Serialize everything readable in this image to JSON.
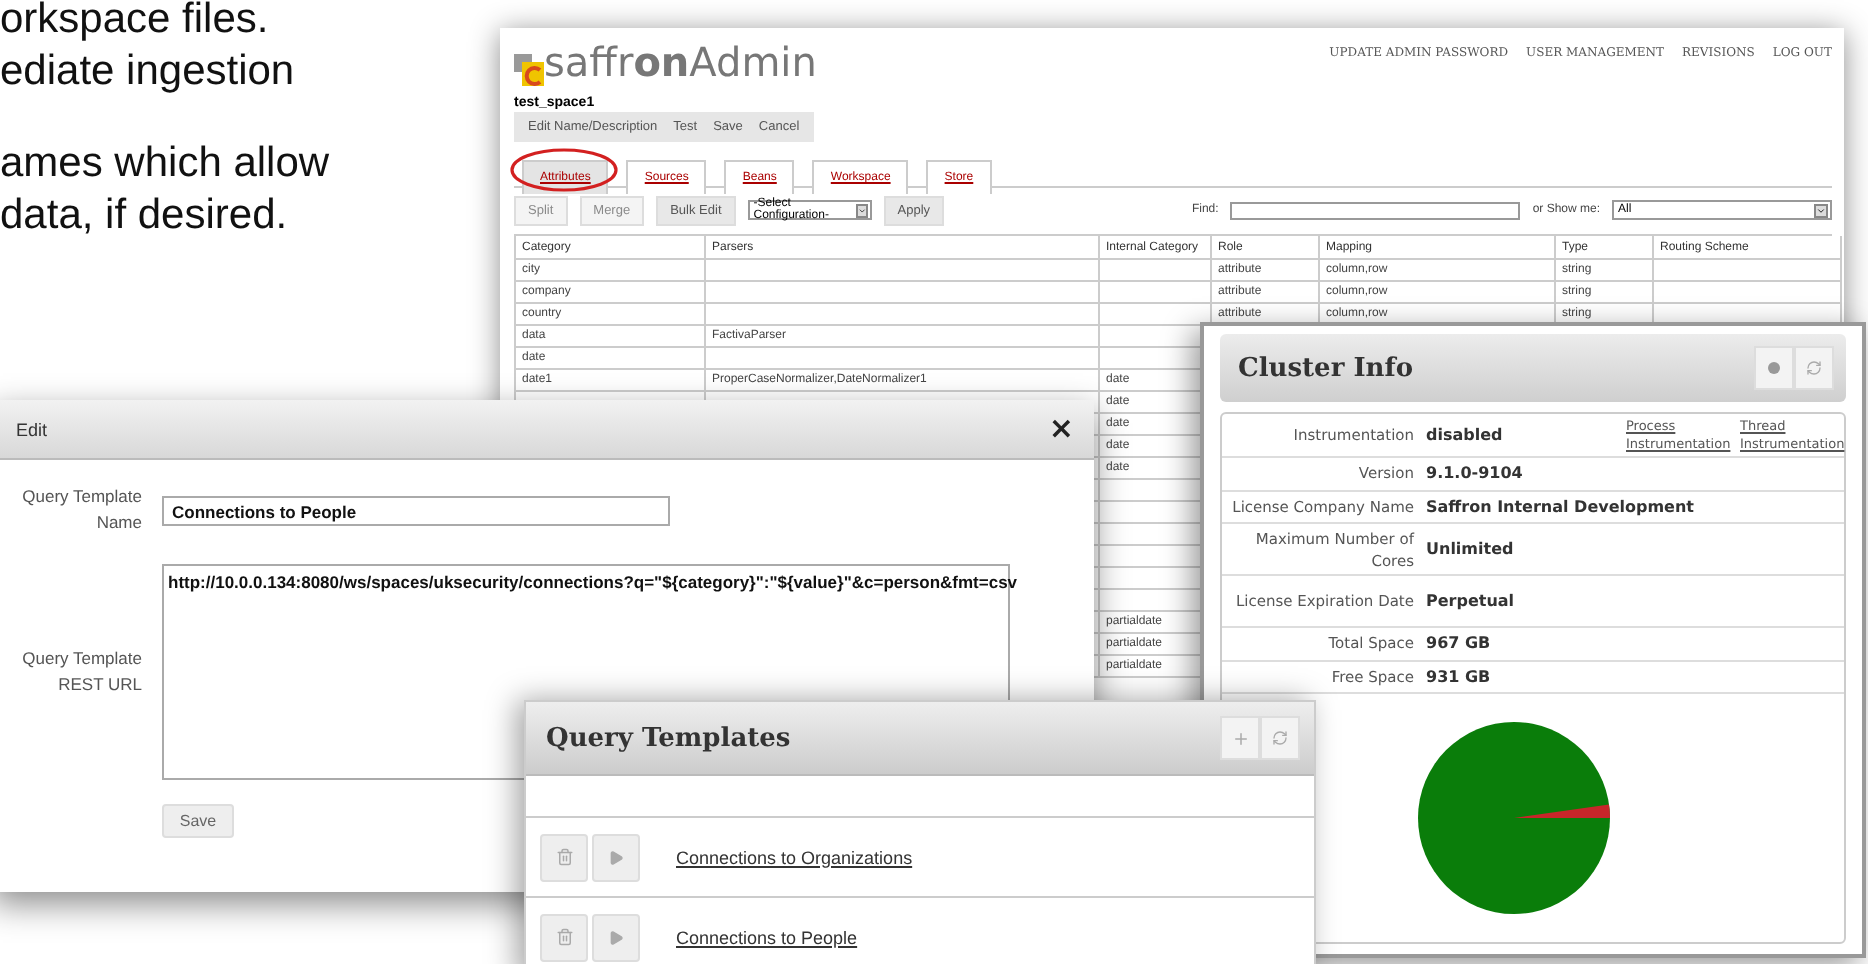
{
  "slide_text": {
    "paragraphs": [
      [
        "orkspace files.",
        "ediate ingestion"
      ],
      [
        "ames which allow",
        "data, if desired."
      ]
    ]
  },
  "admin": {
    "logo": "saffr**on**Admin",
    "nav": [
      "UPDATE ADMIN PASSWORD",
      "USER MANAGEMENT",
      "REVISIONS",
      "LOG OUT"
    ],
    "space_name": "test_space1",
    "actions": [
      "Edit Name/Description",
      "Test",
      "Save",
      "Cancel"
    ],
    "tabs": [
      {
        "label": "Attributes",
        "selected": true,
        "circled": true
      },
      {
        "label": "Sources",
        "selected": false,
        "circled": false
      },
      {
        "label": "Beans",
        "selected": false,
        "circled": false
      },
      {
        "label": "Workspace",
        "selected": false,
        "circled": false
      },
      {
        "label": "Store",
        "selected": false,
        "circled": false
      }
    ],
    "toolbar": {
      "buttons": [
        {
          "label": "Split",
          "disabled": true
        },
        {
          "label": "Merge",
          "disabled": true
        },
        {
          "label": "Bulk Edit",
          "disabled": false
        }
      ],
      "config_select": "-Select Configuration-",
      "apply": "Apply",
      "find_label": "Find:",
      "show_label": "or Show me:",
      "show_select": "All"
    },
    "table": {
      "columns": [
        "Category",
        "Parsers",
        "Internal Category",
        "Role",
        "Mapping",
        "Type",
        "Routing Scheme"
      ],
      "rows": [
        [
          "city",
          null,
          null,
          "attribute",
          "column,row",
          "string",
          null
        ],
        [
          "company",
          null,
          null,
          "attribute",
          "column,row",
          "string",
          null
        ],
        [
          "country",
          null,
          null,
          "attribute",
          "column,row",
          "string",
          null
        ],
        [
          "data",
          "FactivaParser",
          null,
          null,
          null,
          null,
          null
        ],
        [
          "date",
          null,
          null,
          null,
          null,
          null,
          null
        ],
        [
          "date1",
          "ProperCaseNormalizer,DateNormalizer1",
          "date",
          null,
          null,
          null,
          null
        ],
        [
          null,
          null,
          "date",
          null,
          null,
          null,
          null
        ],
        [
          null,
          null,
          "date",
          null,
          null,
          null,
          null
        ],
        [
          null,
          null,
          "date",
          null,
          null,
          null,
          null
        ],
        [
          null,
          null,
          "date",
          null,
          null,
          null,
          null
        ],
        [
          null,
          null,
          null,
          null,
          null,
          null,
          null
        ],
        [
          null,
          null,
          null,
          null,
          null,
          null,
          null
        ],
        [
          null,
          null,
          null,
          null,
          null,
          null,
          null
        ],
        [
          null,
          null,
          null,
          null,
          null,
          null,
          null
        ],
        [
          null,
          null,
          null,
          null,
          null,
          null,
          null
        ],
        [
          null,
          null,
          null,
          null,
          null,
          null,
          null
        ],
        [
          null,
          null,
          "partialdate",
          null,
          null,
          null,
          null
        ],
        [
          null,
          null,
          "partialdate",
          null,
          null,
          null,
          null
        ],
        [
          null,
          null,
          "partialdate",
          null,
          null,
          null,
          null
        ]
      ]
    }
  },
  "edit_dialog": {
    "title": "Edit",
    "close": "×",
    "fields": [
      {
        "kind": "input",
        "label": "Query Template Name",
        "value": "Connections to People"
      },
      {
        "kind": "textarea",
        "label": "Query Template REST URL",
        "value": "http://10.0.0.134:8080/ws/spaces/uksecurity/connections?q=\"${category}\":\"${value}\"&c=person&fmt=csv"
      }
    ],
    "save": "Save"
  },
  "cluster_info": {
    "title": "Cluster Info",
    "rows": [
      {
        "label": "Instrumentation",
        "value": "disabled",
        "links": [
          "Process Instrumentation",
          "Thread Instrumentation"
        ]
      },
      {
        "label": "Version",
        "value": "9.1.0-9104"
      },
      {
        "label": "License Company Name",
        "value": "Saffron Internal Development"
      },
      {
        "label": "Maximum Number of Cores",
        "value": "Unlimited"
      },
      {
        "label": "License Expiration Date",
        "value": "Perpetual"
      },
      {
        "label": "Total Space",
        "value": "967 GB"
      },
      {
        "label": "Free Space",
        "value": "931 GB"
      }
    ]
  },
  "query_templates": {
    "title": "Query Templates",
    "items": [
      "Connections to Organizations",
      "Connections to People"
    ]
  }
}
